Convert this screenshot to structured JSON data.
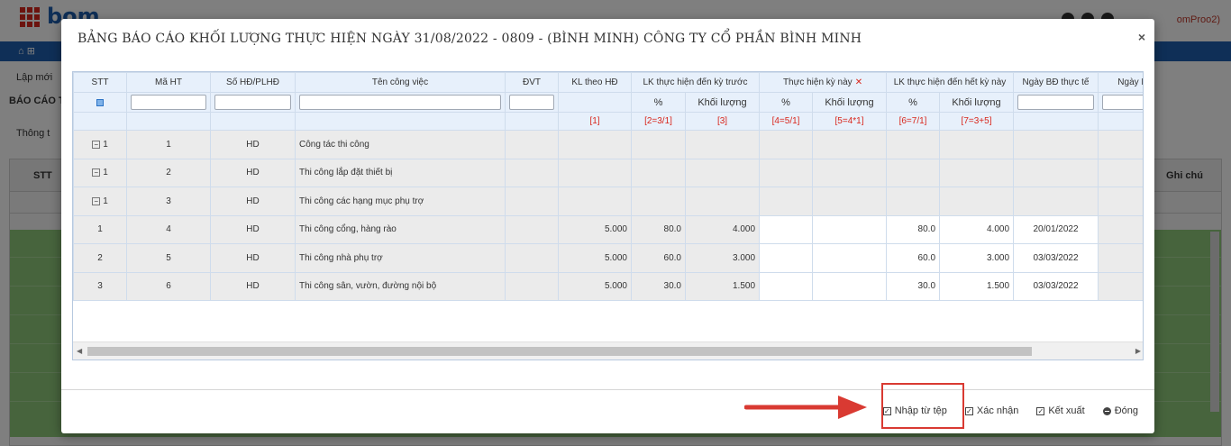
{
  "background": {
    "logo": "bom",
    "user": "omProo2)",
    "toolbar_item": "Lập mới",
    "title": "BÁO CÁO T",
    "tab": "Thông t",
    "grid_col_stt": "STT",
    "grid_col_note": "Ghi chú"
  },
  "modal": {
    "title": "BẢNG BÁO CÁO KHỐI LƯỢNG THỰC HIỆN NGÀY 31/08/2022 - 0809 - (BÌNH MINH) CÔNG TY CỔ PHẦN BÌNH MINH",
    "close_glyph": "×",
    "headers": {
      "stt": "STT",
      "ma_ht": "Mã HT",
      "so_hd": "Số HĐ/PLHĐ",
      "ten_cv": "Tên công việc",
      "dvt": "ĐVT",
      "kl_hd": "KL theo HĐ",
      "lk_truoc": "LK thực hiện đến kỳ trước",
      "th_ky_nay": "Thực hiện kỳ này",
      "lk_het": "LK thực hiện đến hết kỳ này",
      "ngay_bd": "Ngày BĐ thực tế",
      "ngay_ht": "Ngày HT",
      "pct": "%",
      "khoi_luong": "Khối lượng"
    },
    "formulas": {
      "f1": "[1]",
      "f2": "[2=3/1]",
      "f3": "[3]",
      "f4": "[4=5/1]",
      "f5": "[5=4*1]",
      "f6": "[6=7/1]",
      "f7": "[7=3+5]"
    },
    "rows": [
      {
        "stt": "1",
        "ma": "1",
        "hd": "HD",
        "ten": "Công tác thi công",
        "kl": "",
        "p_truoc": "",
        "kl_truoc": "",
        "p_nay": "",
        "kl_nay": "",
        "p_het": "",
        "kl_het": "",
        "ngay": ""
      },
      {
        "stt": "1",
        "ma": "2",
        "hd": "HD",
        "ten": "Thi công lắp đặt thiết bị",
        "kl": "",
        "p_truoc": "",
        "kl_truoc": "",
        "p_nay": "",
        "kl_nay": "",
        "p_het": "",
        "kl_het": "",
        "ngay": ""
      },
      {
        "stt": "1",
        "ma": "3",
        "hd": "HD",
        "ten": "Thi công các hạng mục phụ trợ",
        "kl": "",
        "p_truoc": "",
        "kl_truoc": "",
        "p_nay": "",
        "kl_nay": "",
        "p_het": "",
        "kl_het": "",
        "ngay": ""
      },
      {
        "stt": "1",
        "ma": "4",
        "hd": "HD",
        "ten": "Thi công cổng, hàng rào",
        "kl": "5.000",
        "p_truoc": "80.0",
        "kl_truoc": "4.000",
        "p_nay": "",
        "kl_nay": "",
        "p_het": "80.0",
        "kl_het": "4.000",
        "ngay": "20/01/2022"
      },
      {
        "stt": "2",
        "ma": "5",
        "hd": "HD",
        "ten": "Thi công nhà phụ trợ",
        "kl": "5.000",
        "p_truoc": "60.0",
        "kl_truoc": "3.000",
        "p_nay": "",
        "kl_nay": "",
        "p_het": "60.0",
        "kl_het": "3.000",
        "ngay": "03/03/2022"
      },
      {
        "stt": "3",
        "ma": "6",
        "hd": "HD",
        "ten": "Thi công sân, vườn, đường nội bộ",
        "kl": "5.000",
        "p_truoc": "30.0",
        "kl_truoc": "1.500",
        "p_nay": "",
        "kl_nay": "",
        "p_het": "30.0",
        "kl_het": "1.500",
        "ngay": "03/03/2022"
      }
    ],
    "buttons": {
      "import": "Nhập từ tệp",
      "confirm": "Xác nhận",
      "export": "Kết xuất",
      "close": "Đóng"
    }
  },
  "colors": {
    "accent": "#1f5fae",
    "highlight": "#d93a32",
    "formula": "#d9261c"
  }
}
